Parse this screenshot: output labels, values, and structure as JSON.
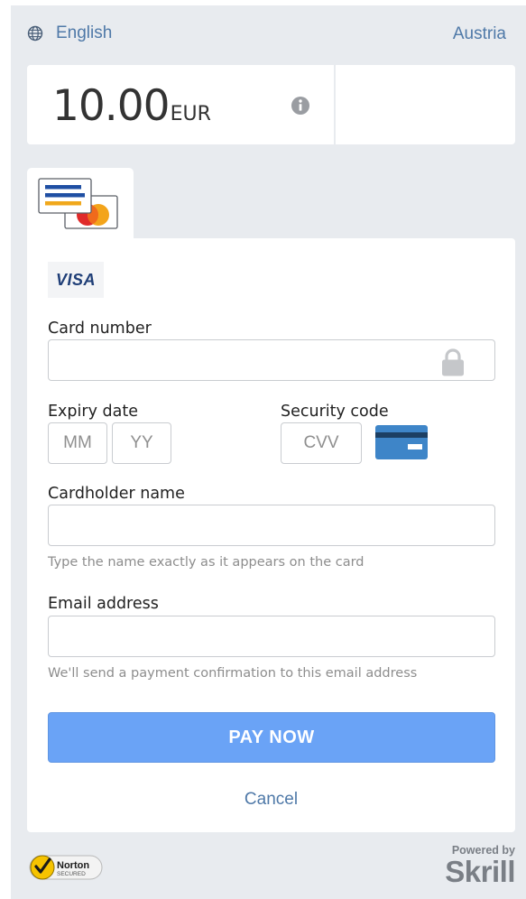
{
  "header": {
    "language": "English",
    "country": "Austria"
  },
  "amount": {
    "value": "10.00",
    "currency": "EUR"
  },
  "payment_method": {
    "brand": "VISA"
  },
  "form": {
    "card_number": {
      "label": "Card number",
      "value": "",
      "placeholder": ""
    },
    "expiry": {
      "label": "Expiry date",
      "month_placeholder": "MM",
      "year_placeholder": "YY"
    },
    "security": {
      "label": "Security code",
      "placeholder": "CVV"
    },
    "cardholder": {
      "label": "Cardholder name",
      "value": "",
      "hint": "Type the name exactly as it appears on the card"
    },
    "email": {
      "label": "Email address",
      "value": "",
      "hint": "We'll send a payment confirmation to this email address"
    },
    "pay_button": "PAY NOW",
    "cancel": "Cancel"
  },
  "footer": {
    "norton_logo": "Norton SECURED",
    "powered_by": "Powered by",
    "skrill_logo": "Skrill"
  },
  "colors": {
    "accent": "#6aa3f6",
    "link": "#4f79a8",
    "background": "#e8ebef"
  }
}
